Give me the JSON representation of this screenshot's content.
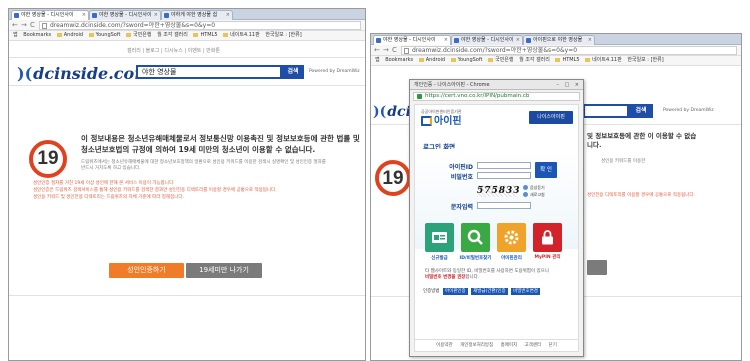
{
  "left": {
    "tabs": [
      {
        "label": "야한 영상물 - 디시인사이"
      },
      {
        "label": "야한 영상물 - 디시인사이"
      },
      {
        "label": "야하게 야한 영상물 쉽"
      }
    ],
    "url": "dreamwiz.dcinside.com/?sword=야한+영상물&s=0&y=0",
    "bookmarks": {
      "apps": "앱",
      "items": [
        "Bookmarks",
        "Android",
        "YoungSoft",
        "국민은행",
        "월 조각 갤러리",
        "HTML5",
        "네이트4.11판",
        "한국일보 : [한류]"
      ]
    },
    "topmenu": "갤러리 | 블로그 | 디시뉴스 | 이벤트 | 만화툰",
    "logo": "dcinside.com",
    "search_value": "야한 영상물",
    "search_button": "검색",
    "powered_by": "Powered by DreamWiz",
    "age_badge": "19",
    "warning_title": "이 정보내용은 청소년유해매체물로서 정보통신망 이용촉진 및 정보보호등에 관한 법률 및 청소년보호법의 규정에 의하여 19세 미만의 청소년이 이용할 수 없습니다.",
    "warning_sub": "드림위즈에서는 청소년유해매체물에 대한 청소년보호정책의 일환으로 성인용 키워드를 이용한 검색시 실명확인 및 성인인증 절차를 반드시 거치도록 하고 있습니다.",
    "warning_red": [
      "성인인증 절차를 거친 19세 이상 성인에 한해 본 서비스 이용이 가능합니다.",
      "성인인증은 드림위즈 검색서비스를 통해 성인용 키워드를 검색한 결과만 성인전용 디렉토리를 이용할 경우에 공통으로 적용됩니다.",
      "성인용 키워드 및 성인전용 디렉토리는 드림위즈의 자체 기준에 따라 정해집니다."
    ],
    "adult_button": "성인인증하기",
    "exit_button": "19세미만 나가기"
  },
  "right": {
    "tabs": [
      {
        "label": "야한 영상물 - 디시인사이"
      },
      {
        "label": "야한 영상물 - 디시인사이"
      },
      {
        "label": "아이핀으로 야한 영상물"
      }
    ],
    "url": "dreamwiz.dcinside.com/?sword=야한+영상물&s=0&y=0",
    "bookmarks": {
      "apps": "앱",
      "items": [
        "Bookmarks",
        "Android",
        "YoungSoft",
        "국민은행",
        "월 조각 갤러리",
        "HTML5",
        "네이트4.11판",
        "한국일보 : [한류]"
      ]
    },
    "logo": "dcinside.com",
    "search_button": "검색",
    "powered_by": "Powered by DreamWiz",
    "age_badge": "19",
    "warning_partial": "및 정보보호등에 관한 이 이용할 수 없습니다.",
    "warning_partial_sub": "성인용 키워드를 이용한",
    "warning_red_partial": "성인전용 디렉토리를 이용할 경우에 공통으로 적용됩니다."
  },
  "popup": {
    "window_title": "개인인증 - 나이스아이핀 - Chrome",
    "url": "https://cert.vno.co.kr/IPIN/pubmain.cb",
    "org": "공공아이핀센터인증기관",
    "brand": "아이핀",
    "banner": "나이스아이핀",
    "section_title": "로그인 화면",
    "id_label": "아이핀ID",
    "pw_label": "비밀번호",
    "captcha_label": "문자입력",
    "captcha_text": "575833",
    "ok_button": "확 인",
    "refresh_button": "새로고침",
    "sound_button": "음성듣기",
    "tiles": [
      {
        "label": "신규발급",
        "color": "#2aa37a"
      },
      {
        "label": "ID/비밀번호찾기",
        "color": "#3aa843"
      },
      {
        "label": "아이핀관리",
        "color": "#f0a32a"
      },
      {
        "label": "MyPIN 관리",
        "color": "#d2232a"
      }
    ],
    "notice": "타 웹사이트와 동일한 ID, 비밀번호를 사용하면 도용위험이 있으니",
    "notice_bold": "비밀번호 변경을 권장",
    "notice_tail": "합니다.",
    "links_label": "인증방법",
    "links": [
      "아이핀인증",
      "재발급(간편)인증",
      "비밀번호변경"
    ],
    "footer": [
      "이용약관",
      "개인정보처리방침",
      "홈페이지",
      "고객센터",
      "닫기"
    ]
  }
}
